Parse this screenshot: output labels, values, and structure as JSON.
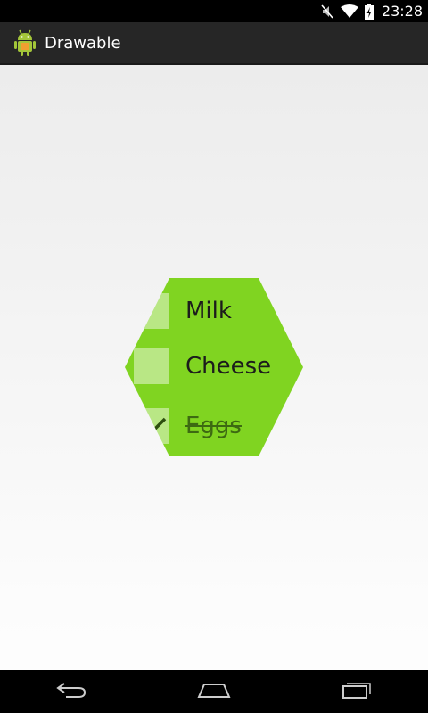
{
  "status_bar": {
    "time": "23:28",
    "icons": [
      "mute-icon",
      "wifi-icon",
      "battery-icon"
    ]
  },
  "action_bar": {
    "title": "Drawable",
    "app_icon": "android-icon"
  },
  "checklist": {
    "items": [
      {
        "label": "Milk",
        "checked": false
      },
      {
        "label": "Cheese",
        "checked": false
      },
      {
        "label": "Eggs",
        "checked": true
      }
    ]
  },
  "nav_bar": {
    "buttons": [
      "back-icon",
      "home-icon",
      "recents-icon"
    ]
  },
  "colors": {
    "hexagon": "#80d421",
    "action_bar": "#262626"
  }
}
